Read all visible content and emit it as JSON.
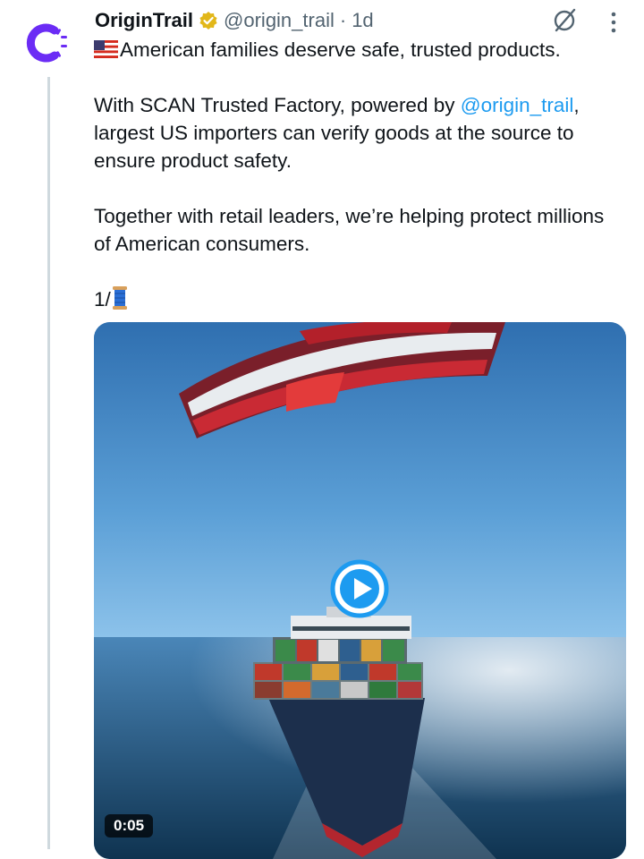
{
  "tweet": {
    "display_name": "OriginTrail",
    "handle": "@origin_trail",
    "separator": "·",
    "time": "1d",
    "text": {
      "line1": "American families deserve safe, trusted products.",
      "line2_pre": "With SCAN Trusted Factory, powered by ",
      "line2_mention": "@origin_trail",
      "line2_post": ",",
      "line3": "largest US importers can verify goods at the source to",
      "line4": "ensure product safety.",
      "line5": "Together with retail leaders, we’re helping protect millions",
      "line6": "of American consumers.",
      "line7": "1/"
    },
    "media": {
      "duration": "0:05"
    }
  },
  "icons": {
    "avatar": "origintrail-logo",
    "verified": "verified-badge-icon",
    "grok": "grok-icon",
    "more": "more-icon",
    "play": "play-icon"
  },
  "colors": {
    "avatar_purple": "#6b2cf5",
    "verified_gold": "#e2b719",
    "mention_blue": "#1d9bf0",
    "play_blue": "#1d9bf0",
    "text_primary": "#0f1419",
    "text_secondary": "#536471"
  }
}
